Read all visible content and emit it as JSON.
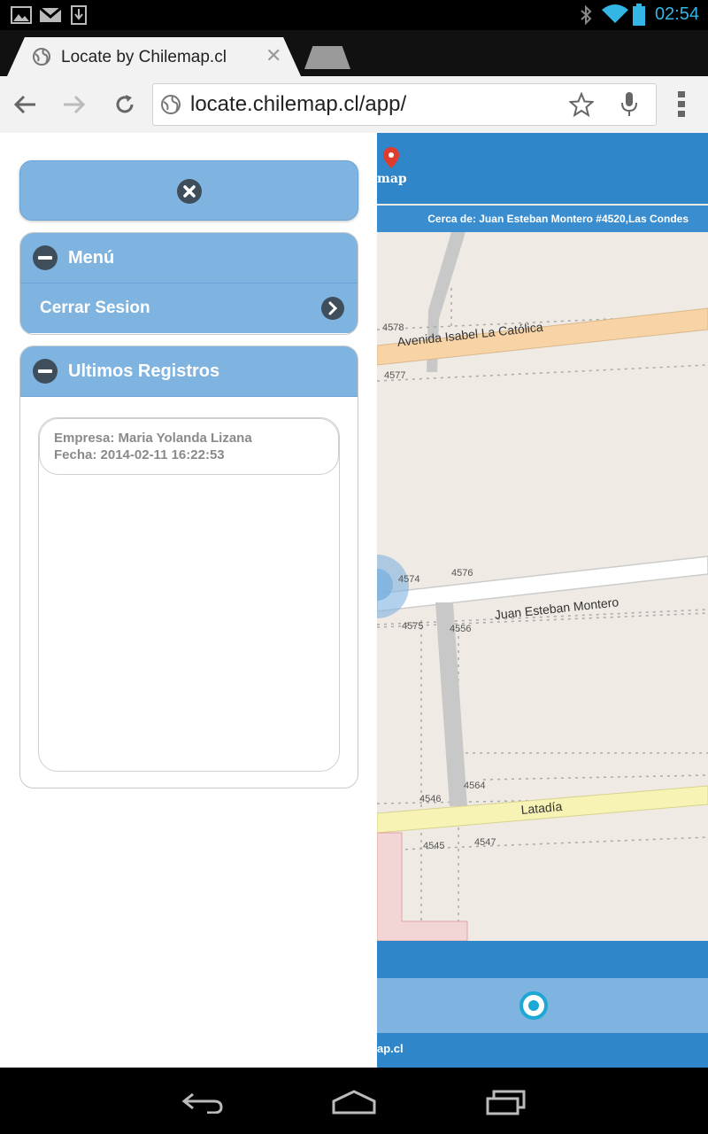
{
  "status_bar": {
    "time": "02:54"
  },
  "browser": {
    "tab_title": "Locate by Chilemap.cl",
    "url": "locate.chilemap.cl/app/"
  },
  "panel": {
    "menu_section_title": "Menú",
    "logout_label": "Cerrar Sesion",
    "records_section_title": "Ultimos Registros",
    "records": [
      {
        "empresa": "Empresa: Maria Yolanda Lizana",
        "fecha": "Fecha: 2014-02-11 16:22:53"
      }
    ]
  },
  "map": {
    "header_partial_text": "map",
    "near_text": "Cerca de: Juan Esteban Montero #4520,Las Condes",
    "footer_partial_text": "ap.cl",
    "streets": {
      "avenida": "Avenida Isabel La Católica",
      "juan": "Juan Esteban Montero",
      "latadia": "Latadía"
    },
    "numbers": {
      "n4578": "4578",
      "n4577": "4577",
      "n4574": "4574",
      "n4576": "4576",
      "n4575": "4575",
      "n4556": "4556",
      "n4564": "4564",
      "n4546": "4546",
      "n4545": "4545",
      "n4547": "4547"
    }
  },
  "colors": {
    "accent_blue": "#2f86c8",
    "light_blue": "#7fb3e0",
    "android_blue": "#33b5e5"
  },
  "icons": {
    "close": "close-icon",
    "collapse": "minus-icon",
    "chevron": "chevron-right-icon",
    "locate": "locate-icon"
  }
}
